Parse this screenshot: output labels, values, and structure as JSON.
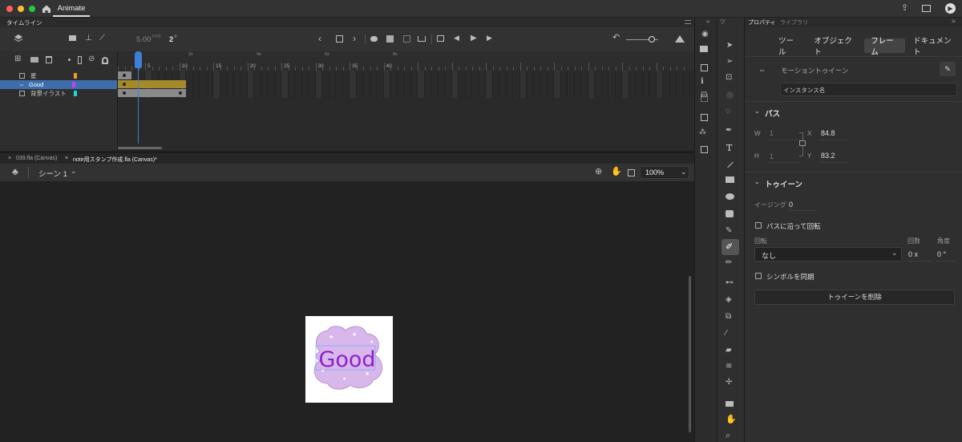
{
  "app": {
    "title": "Animate"
  },
  "timeline": {
    "panel_title": "タイムライン",
    "fps": "5.00",
    "fps_unit": "FPS",
    "current_frame": "2",
    "frame_unit": "F",
    "ruler_seconds": [
      "2s",
      "4s",
      "6s",
      "8s"
    ],
    "ruler_frames": [
      "5",
      "10",
      "15",
      "20",
      "25",
      "30",
      "35",
      "40"
    ],
    "layers": [
      {
        "name": "星",
        "color": "#f0a020"
      },
      {
        "name": "Good",
        "color": "#c040ff",
        "selected": true
      },
      {
        "name": "背景イラスト",
        "color": "#19d9e0"
      }
    ]
  },
  "documents": {
    "tabs": [
      "039.fla (Canvas)",
      "note用スタンプ作成.fla (Canvas)*"
    ],
    "scene": "シーン 1",
    "zoom": "100%"
  },
  "canvas": {
    "word": "Good"
  },
  "properties": {
    "panel_tabs": [
      "プロパティ",
      "ライブラリ"
    ],
    "sub_tabs": [
      "ツール",
      "オブジェクト",
      "フレーム",
      "ドキュメント"
    ],
    "active_sub_tab": "フレーム",
    "object_type": "モーショントゥイーン",
    "instance_placeholder": "インスタンス名",
    "path_section": "パス",
    "w_label": "W",
    "w_value": "1",
    "h_label": "H",
    "h_value": "1",
    "x_label": "X",
    "x_value": "84.8",
    "y_label": "Y",
    "y_value": "83.2",
    "tween_section": "トゥイーン",
    "easing_label": "イージング",
    "easing_value": "0",
    "orient_label": "パスに沿って回転",
    "rotate_label": "回転",
    "count_label": "回数",
    "angle_label": "角度",
    "rotate_value": "なし",
    "count_value": "0 x",
    "angle_value": "0 °",
    "sync_label": "シンボルを同期",
    "delete_button": "トゥイーンを削除"
  }
}
